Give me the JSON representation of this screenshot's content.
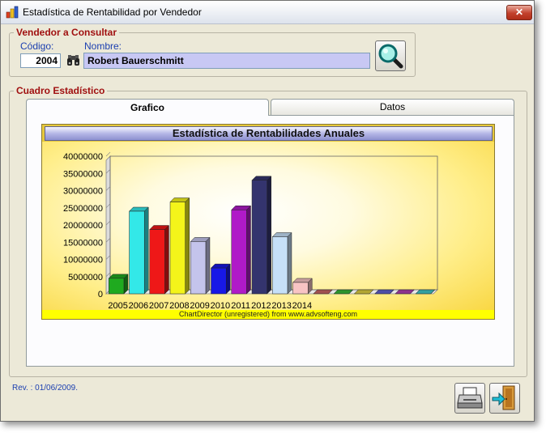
{
  "window": {
    "title": "Estadística de Rentabilidad por Vendedor",
    "close_label": "✕",
    "icon_name": "app-chart-icon"
  },
  "vendedor": {
    "group_title": "Vendedor a Consultar",
    "codigo_label": "Código:",
    "codigo_value": "2004",
    "nombre_label": "Nombre:",
    "nombre_value": "Robert Bauerschmitt",
    "binoculars_icon": "binoculars-icon",
    "search_icon": "magnifier-icon"
  },
  "cuadro": {
    "group_title": "Cuadro Estadístico",
    "tabs": [
      {
        "label": "Grafico",
        "active": true
      },
      {
        "label": "Datos",
        "active": false
      }
    ]
  },
  "chart_data": {
    "type": "bar",
    "title": "Estadística de Rentabilidades Anuales",
    "categories": [
      "2005",
      "2006",
      "2007",
      "2008",
      "2009",
      "2010",
      "2011",
      "2012",
      "2013",
      "2014",
      "",
      "",
      "",
      "",
      "",
      ""
    ],
    "values": [
      4500000,
      24000000,
      18700000,
      26700000,
      15200000,
      7500000,
      24400000,
      33000000,
      16600000,
      3300000,
      0,
      0,
      0,
      0,
      0,
      0
    ],
    "colors": [
      "#1faa1f",
      "#33e8e8",
      "#ee1818",
      "#f4f41a",
      "#c4c4ec",
      "#1818e6",
      "#b01ac8",
      "#34346e",
      "#c6e0f8",
      "#f8c4c4",
      "#c86464",
      "#38b838",
      "#e0d040",
      "#6060d0",
      "#b040b0",
      "#40c8c8"
    ],
    "yticks": [
      "40000000",
      "35000000",
      "30000000",
      "25000000",
      "20000000",
      "15000000",
      "10000000",
      "5000000",
      "0"
    ],
    "ylim": [
      0,
      40000000
    ],
    "footer": "ChartDirector (unregistered) from www.advsofteng.com"
  },
  "footer": {
    "revision": "Rev. : 01/06/2009.",
    "print_icon": "printer-icon",
    "exit_icon": "exit-door-icon"
  }
}
